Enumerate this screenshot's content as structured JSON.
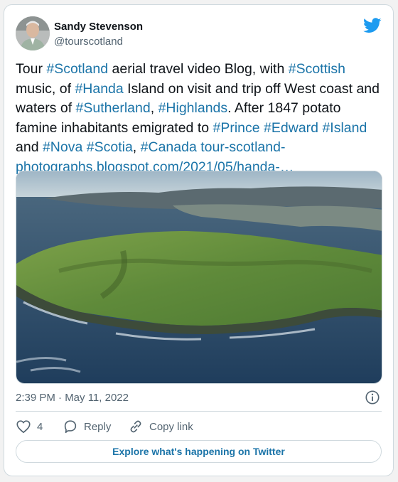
{
  "user": {
    "display_name": "Sandy Stevenson",
    "handle": "@tourscotland"
  },
  "tweet": {
    "segments": [
      {
        "text": "Tour ",
        "link": false
      },
      {
        "text": "#Scotland",
        "link": true
      },
      {
        "text": " aerial travel video Blog, with ",
        "link": false
      },
      {
        "text": "#Scottish",
        "link": true
      },
      {
        "text": " music, of ",
        "link": false
      },
      {
        "text": "#Handa",
        "link": true
      },
      {
        "text": " Island on visit and trip off West coast and waters of ",
        "link": false
      },
      {
        "text": "#Sutherland",
        "link": true
      },
      {
        "text": ", ",
        "link": false
      },
      {
        "text": "#Highlands",
        "link": true
      },
      {
        "text": ". After 1847 potato famine inhabitants emigrated to ",
        "link": false
      },
      {
        "text": "#Prince",
        "link": true
      },
      {
        "text": " ",
        "link": false
      },
      {
        "text": "#Edward",
        "link": true
      },
      {
        "text": " ",
        "link": false
      },
      {
        "text": "#Island",
        "link": true
      },
      {
        "text": " and ",
        "link": false
      },
      {
        "text": "#Nova",
        "link": true
      },
      {
        "text": " ",
        "link": false
      },
      {
        "text": "#Scotia",
        "link": true
      },
      {
        "text": ", ",
        "link": false
      },
      {
        "text": "#Canada",
        "link": true
      },
      {
        "text": " ",
        "link": false
      },
      {
        "text": "tour-scotland-photographs.blogspot.com/2021/05/handa-…",
        "link": true
      }
    ]
  },
  "timestamp": "2:39 PM · May 11, 2022",
  "actions": {
    "like_count": "4",
    "reply_label": "Reply",
    "copy_label": "Copy link"
  },
  "explore_label": "Explore what's happening on Twitter",
  "colors": {
    "link": "#1b74a8",
    "twitter_blue": "#1d9bf0",
    "text": "#0f1419",
    "muted": "#536471",
    "border": "#cfd9de"
  },
  "icons": {
    "logo": "twitter-bird-icon",
    "info": "info-icon",
    "like": "heart-icon",
    "reply": "speech-bubble-icon",
    "copy": "link-chain-icon"
  }
}
